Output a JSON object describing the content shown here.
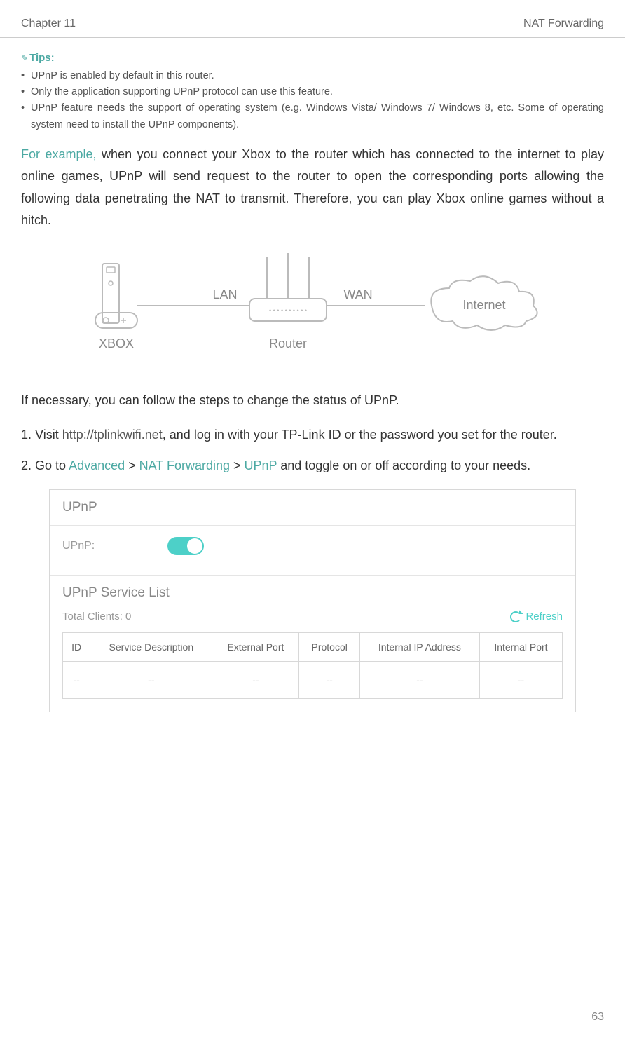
{
  "header": {
    "left": "Chapter 11",
    "right": "NAT Forwarding"
  },
  "tips": {
    "label": "Tips:",
    "items": [
      "UPnP is enabled by default in this router.",
      "Only the application supporting UPnP protocol can use this feature.",
      "UPnP feature needs the support of operating system (e.g. Windows Vista/ Windows 7/ Windows 8, etc. Some of operating system need to install the UPnP components)."
    ]
  },
  "example": {
    "lead": "For example,",
    "body": " when you connect your Xbox to the router which has connected to the internet to play online games, UPnP will send request to the router to open the corresponding ports allowing the following data penetrating the NAT to transmit. Therefore, you can play Xbox online games without a hitch."
  },
  "diagram": {
    "xbox": "XBOX",
    "lan": "LAN",
    "wan": "WAN",
    "router": "Router",
    "internet": "Internet"
  },
  "intro": "If necessary, you can follow the steps to change the status of UPnP.",
  "steps": [
    {
      "num": "1. ",
      "pre": "Visit ",
      "link": "http://tplinkwifi.net",
      "post": ", and log in with your TP-Link ID or the password you set for the router."
    },
    {
      "num": "2. ",
      "pre": "Go to ",
      "t1": "Advanced",
      "sep1": " > ",
      "t2": "NAT Forwarding",
      "sep2": " > ",
      "t3": "UPnP",
      "post": " and toggle on or off according to your needs."
    }
  ],
  "panel": {
    "title": "UPnP",
    "upnp_label": "UPnP:",
    "service_title": "UPnP Service List",
    "total_clients": "Total Clients: 0",
    "refresh": "Refresh",
    "cols": [
      "ID",
      "Service Description",
      "External Port",
      "Protocol",
      "Internal IP Address",
      "Internal Port"
    ],
    "empty": "--"
  },
  "page_num": "63"
}
